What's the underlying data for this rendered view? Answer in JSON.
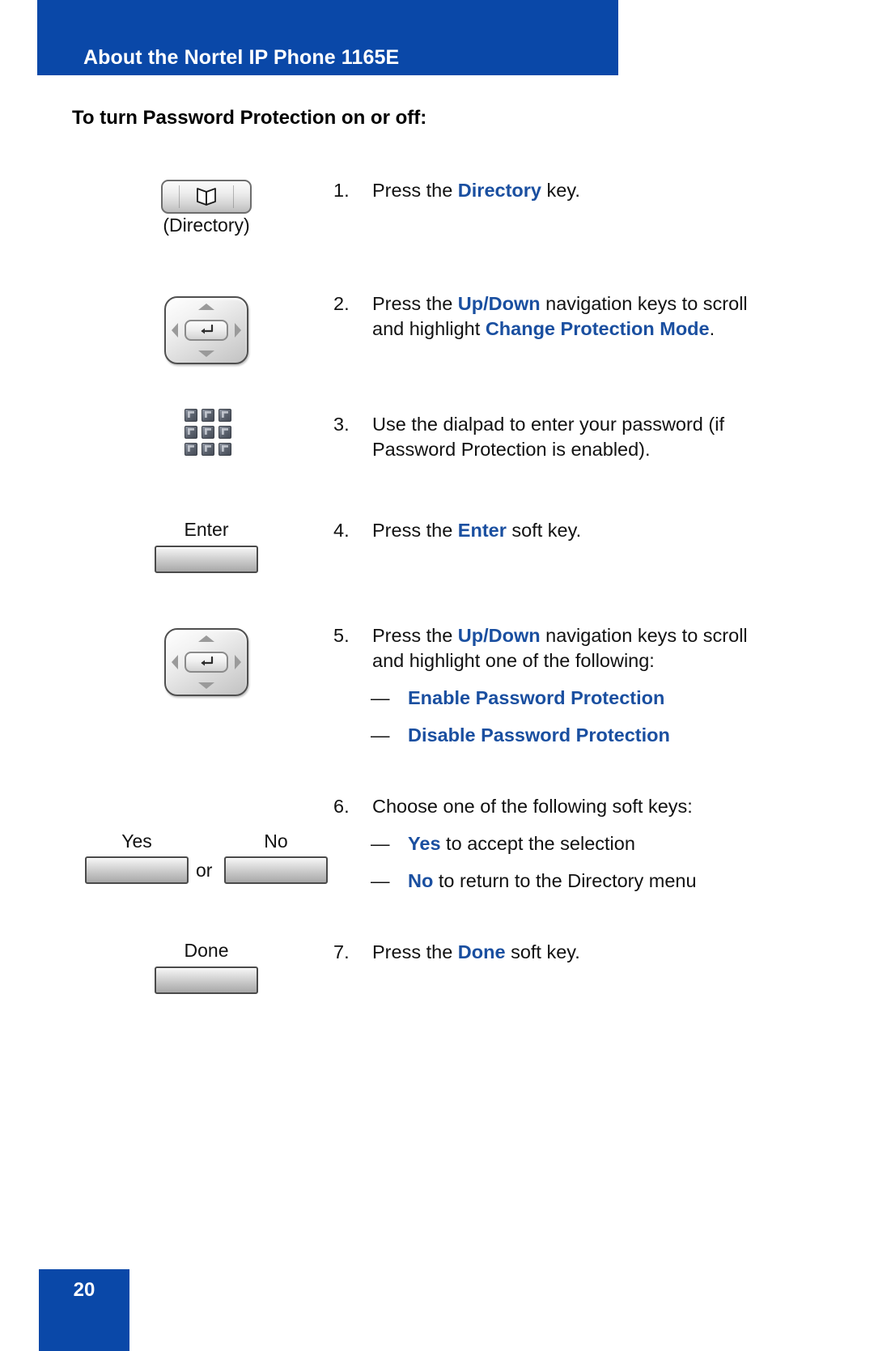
{
  "header": {
    "title": "About the Nortel IP Phone 1165E",
    "bar_color": "#0A48A8"
  },
  "section": {
    "heading": "To turn Password Protection on or off:"
  },
  "accent_color": "#1A4FA0",
  "keys": {
    "directory": {
      "caption": "(Directory)",
      "icon": "book-icon"
    },
    "navigation": {
      "icon": "navigation-cluster-icon",
      "center_icon": "enter-arrow-icon"
    },
    "dialpad": {
      "icon": "dialpad-icon"
    },
    "enter_softkey": {
      "label": "Enter"
    },
    "yes_softkey": {
      "label": "Yes"
    },
    "no_softkey": {
      "label": "No"
    },
    "or_text": "or",
    "done_softkey": {
      "label": "Done"
    }
  },
  "steps": [
    {
      "num": "1.",
      "parts": [
        {
          "text": "Press the ",
          "style": "plain"
        },
        {
          "text": "Directory",
          "style": "accent"
        },
        {
          "text": " key.",
          "style": "plain"
        }
      ]
    },
    {
      "num": "2.",
      "parts": [
        {
          "text": "Press the ",
          "style": "plain"
        },
        {
          "text": "Up",
          "style": "accent"
        },
        {
          "text": "/",
          "style": "accent"
        },
        {
          "text": "Down",
          "style": "accent"
        },
        {
          "text": " navigation keys to scroll and highlight ",
          "style": "plain"
        },
        {
          "text": "Change Protection Mode",
          "style": "accent"
        },
        {
          "text": ".",
          "style": "plain"
        }
      ]
    },
    {
      "num": "3.",
      "parts": [
        {
          "text": "Use the dialpad to enter your password (if Password Protection is enabled).",
          "style": "plain"
        }
      ]
    },
    {
      "num": "4.",
      "parts": [
        {
          "text": "Press the ",
          "style": "plain"
        },
        {
          "text": "Enter",
          "style": "accent"
        },
        {
          "text": " soft key.",
          "style": "plain"
        }
      ]
    },
    {
      "num": "5.",
      "parts": [
        {
          "text": "Press the ",
          "style": "plain"
        },
        {
          "text": "Up",
          "style": "accent"
        },
        {
          "text": "/",
          "style": "accent"
        },
        {
          "text": "Down",
          "style": "accent"
        },
        {
          "text": " navigation keys to scroll and highlight one of the following:",
          "style": "plain"
        }
      ]
    },
    {
      "num": "6.",
      "parts": [
        {
          "text": "Choose one of the following soft keys:",
          "style": "plain"
        }
      ]
    },
    {
      "num": "7.",
      "parts": [
        {
          "text": "Press the ",
          "style": "plain"
        },
        {
          "text": "Done",
          "style": "accent"
        },
        {
          "text": " soft key.",
          "style": "plain"
        }
      ]
    }
  ],
  "sub_items": {
    "step5": [
      {
        "dash": "—",
        "parts": [
          {
            "text": "Enable Password Protection",
            "style": "accent"
          }
        ]
      },
      {
        "dash": "—",
        "parts": [
          {
            "text": "Disable Password Protection",
            "style": "accent"
          }
        ]
      }
    ],
    "step6": [
      {
        "dash": "—",
        "parts": [
          {
            "text": "Yes",
            "style": "accent"
          },
          {
            "text": " to accept the selection",
            "style": "plain"
          }
        ]
      },
      {
        "dash": "—",
        "parts": [
          {
            "text": "No",
            "style": "accent"
          },
          {
            "text": " to return to the Directory menu",
            "style": "plain"
          }
        ]
      }
    ]
  },
  "footer": {
    "page_number": "20",
    "box_color": "#0A48A8"
  }
}
